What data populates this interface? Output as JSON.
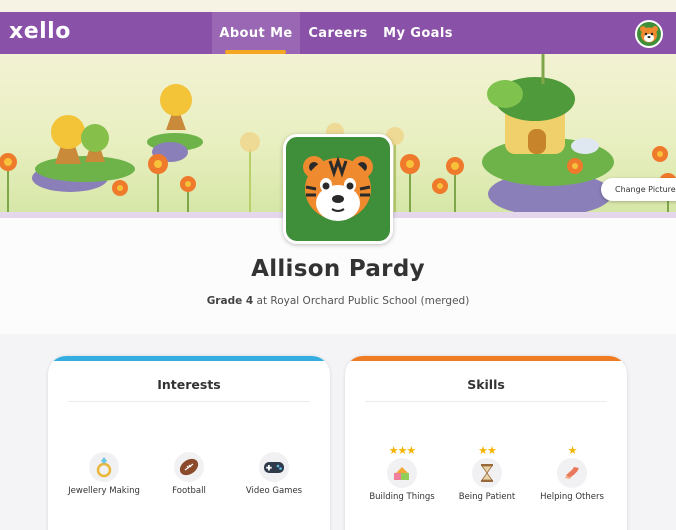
{
  "header": {
    "logo": "xello",
    "tabs": [
      {
        "label": "About Me"
      },
      {
        "label": "Careers"
      },
      {
        "label": "My Goals"
      }
    ],
    "active_tab": "About Me",
    "user_avatar_icon": "tiger-icon"
  },
  "banner": {
    "change_pictures_label": "Change Pictures"
  },
  "profile": {
    "name": "Allison Pardy",
    "grade": "Grade 4",
    "school": " at Royal Orchard Public School (merged)",
    "avatar_icon": "tiger-icon"
  },
  "interests": {
    "title": "Interests",
    "items": [
      {
        "label": "Jewellery Making",
        "icon": "ring-icon"
      },
      {
        "label": "Football",
        "icon": "football-icon"
      },
      {
        "label": "Video Games",
        "icon": "gamepad-icon"
      }
    ]
  },
  "skills": {
    "title": "Skills",
    "items": [
      {
        "label": "Building Things",
        "icon": "blocks-icon",
        "stars": 3
      },
      {
        "label": "Being Patient",
        "icon": "hourglass-icon",
        "stars": 2
      },
      {
        "label": "Helping Others",
        "icon": "helping-hands-icon",
        "stars": 1
      }
    ]
  },
  "colors": {
    "nav": "#8a51a8",
    "interests_accent": "#34aee0",
    "skills_accent": "#ef7c22",
    "star": "#f5b301",
    "avatar_bg": "#3f8e3a"
  }
}
